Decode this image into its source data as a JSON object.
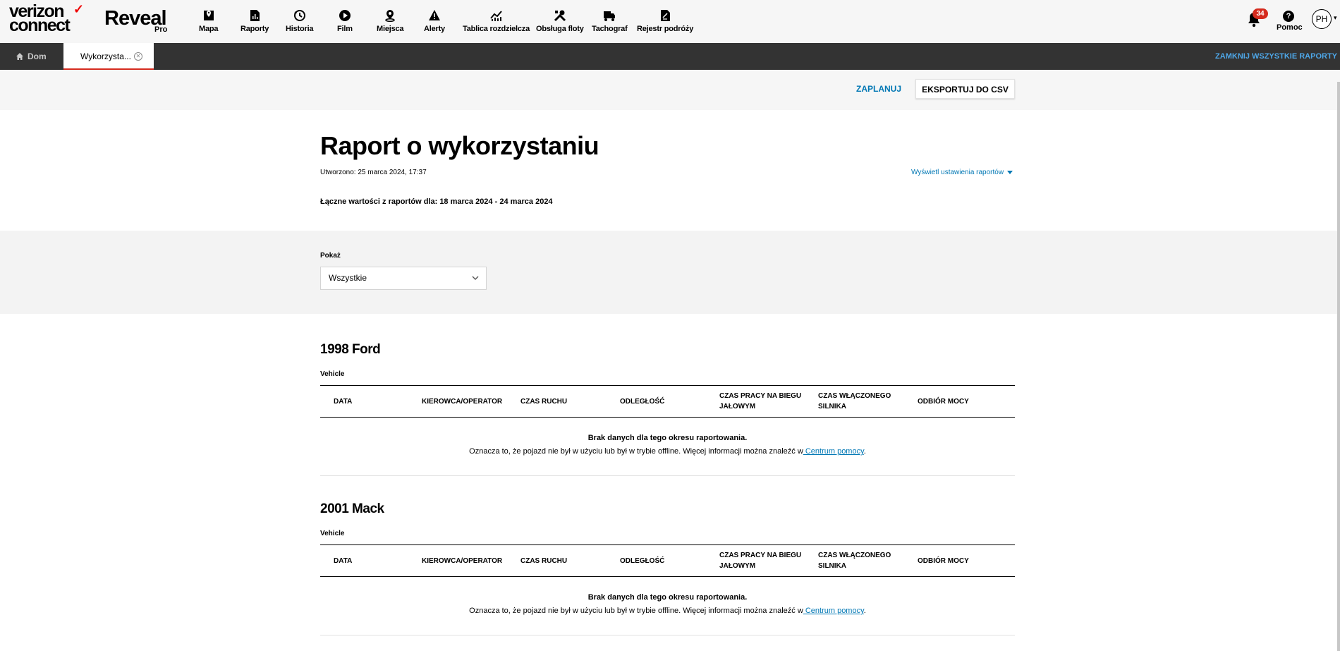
{
  "brand": {
    "logo_text": "verizon connect",
    "product": "Reveal",
    "product_tier": "Pro"
  },
  "nav": [
    {
      "label": "Mapa",
      "icon": "map-icon"
    },
    {
      "label": "Raporty",
      "icon": "reports-icon"
    },
    {
      "label": "Historia",
      "icon": "history-icon"
    },
    {
      "label": "Film",
      "icon": "play-icon"
    },
    {
      "label": "Miejsca",
      "icon": "places-icon"
    },
    {
      "label": "Alerty",
      "icon": "alert-icon"
    },
    {
      "label": "Tablica rozdzielcza",
      "icon": "dashboard-icon"
    },
    {
      "label": "Obsługa floty",
      "icon": "tools-icon"
    },
    {
      "label": "Tachograf",
      "icon": "truck-icon"
    },
    {
      "label": "Rejestr podróży",
      "icon": "logbook-icon"
    }
  ],
  "header_right": {
    "notifications_count": "34",
    "help_label": "Pomoc",
    "help_glyph": "?",
    "avatar_initials": "PH"
  },
  "tabs": {
    "home_label": "Dom",
    "active_label": "Wykorzysta...",
    "close_all_label": "ZAMKNIJ WSZYSTKIE RAPORTY"
  },
  "actions": {
    "schedule_label": "ZAPLANUJ",
    "export_label": "EKSPORTUJ DO CSV"
  },
  "report": {
    "title": "Raport o wykorzystaniu",
    "created": "Utworzono: 25 marca 2024, 17:37",
    "settings_link": "Wyświetl ustawienia raportów",
    "totals": "Łączne wartości z raportów dla: 18 marca 2024 - 24 marca 2024"
  },
  "filter": {
    "label": "Pokaż",
    "selected": "Wszystkie"
  },
  "table_columns": [
    "DATA",
    "KIEROWCA/OPERATOR",
    "CZAS RUCHU",
    "ODLEGŁOŚĆ",
    "CZAS PRACY NA BIEGU JAŁOWYM",
    "CZAS WŁĄCZONEGO SILNIKA",
    "ODBIÓR MOCY"
  ],
  "vehicles": [
    {
      "name": "1998 Ford",
      "type": "Vehicle"
    },
    {
      "name": "2001 Mack",
      "type": "Vehicle"
    }
  ],
  "no_data": {
    "title": "Brak danych dla tego okresu raportowania.",
    "text": "Oznacza to, że pojazd nie był w użyciu lub był w trybie offline. Więcej informacji można znaleźć w",
    "link": " Centrum pomocy",
    "suffix": "."
  },
  "colors": {
    "accent_blue": "#0077b4",
    "tab_bar": "#333333",
    "brand_red": "#d52b1e",
    "close_all_link": "#4ea7e8"
  }
}
